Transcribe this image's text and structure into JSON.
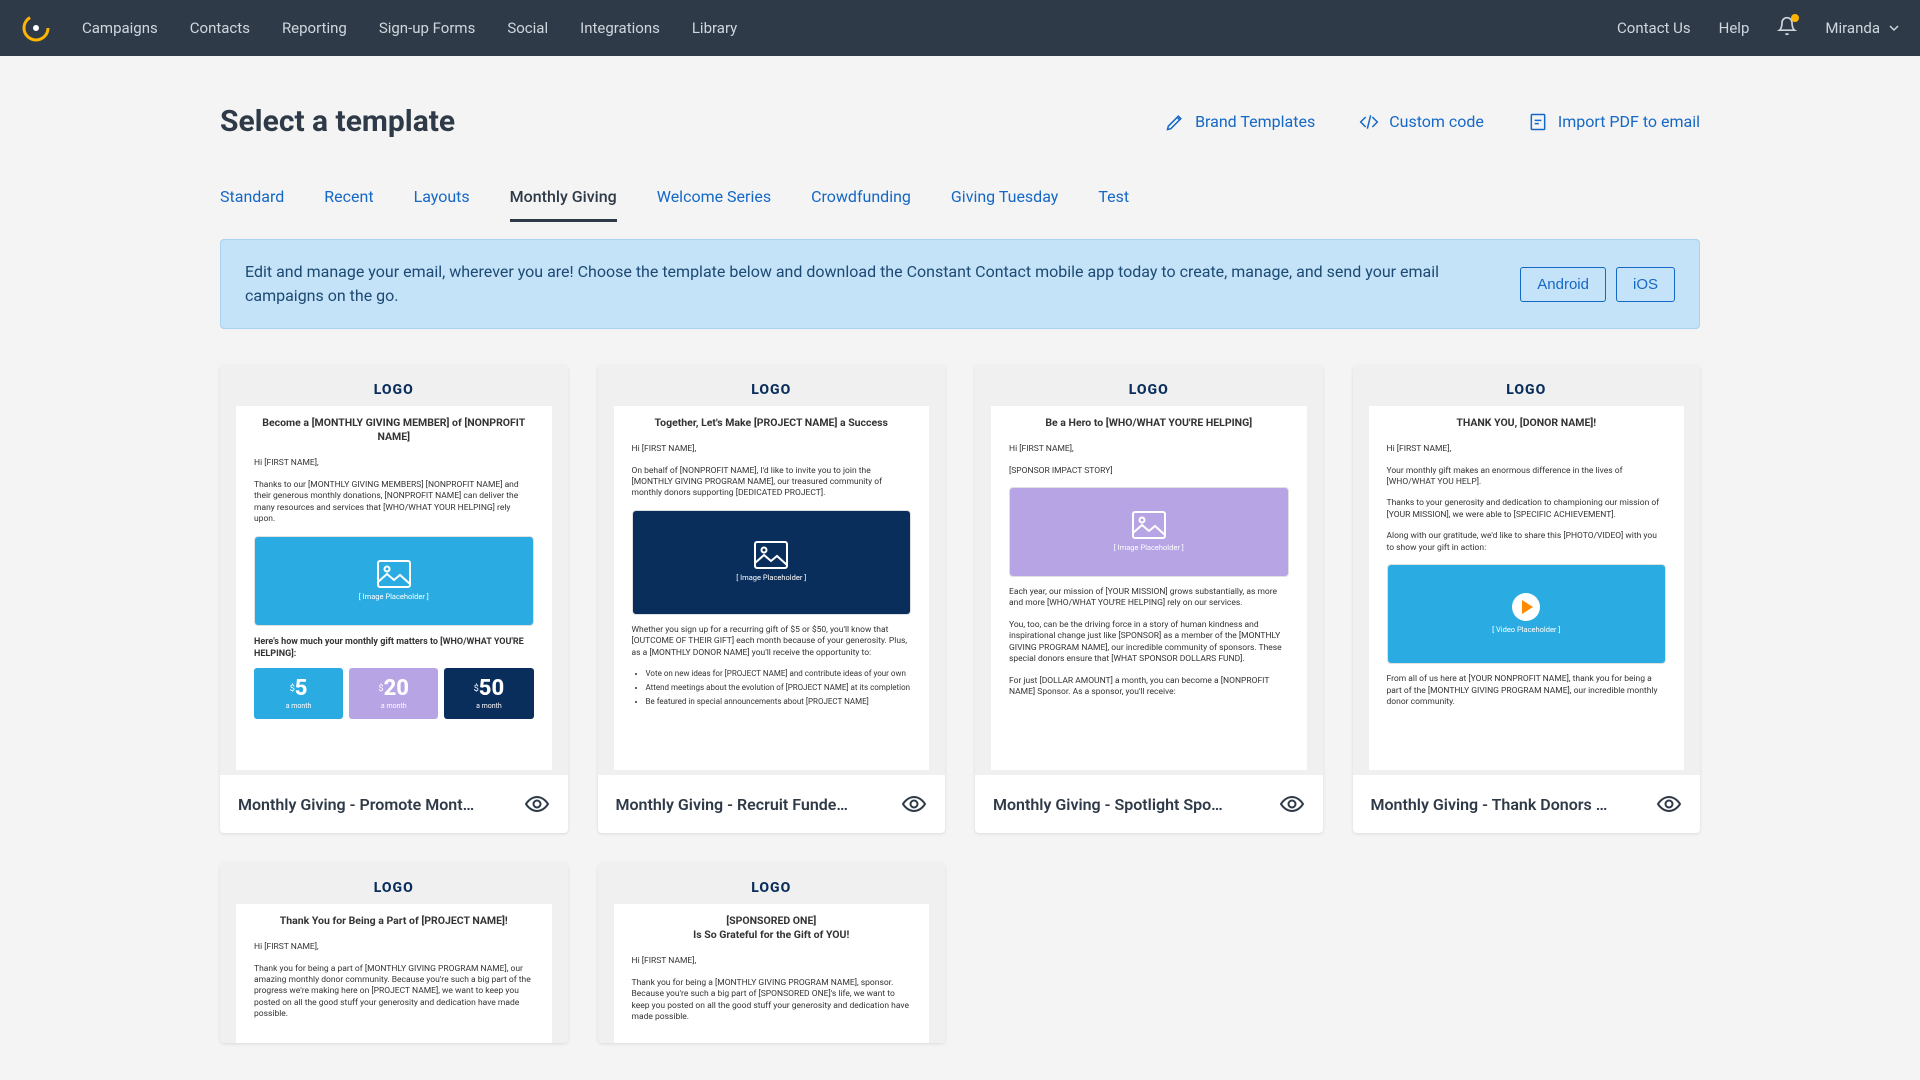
{
  "header": {
    "nav": [
      "Campaigns",
      "Contacts",
      "Reporting",
      "Sign-up Forms",
      "Social",
      "Integrations",
      "Library"
    ],
    "contact": "Contact Us",
    "help": "Help",
    "user": "Miranda"
  },
  "page": {
    "title": "Select a template",
    "actions": {
      "brand": "Brand Templates",
      "custom": "Custom code",
      "import": "Import PDF to email"
    }
  },
  "tabs": [
    "Standard",
    "Recent",
    "Layouts",
    "Monthly Giving",
    "Welcome Series",
    "Crowdfunding",
    "Giving Tuesday",
    "Test"
  ],
  "active_tab": 3,
  "banner": {
    "text": "Edit and manage your email, wherever you are! Choose the template below and download the Constant Contact mobile app today to create, manage, and send your email campaigns on the go.",
    "android": "Android",
    "ios": "iOS"
  },
  "templates": [
    {
      "title": "Monthly Giving - Promote Mont…"
    },
    {
      "title": "Monthly Giving - Recruit Funde…"
    },
    {
      "title": "Monthly Giving - Spotlight Spo…"
    },
    {
      "title": "Monthly Giving - Thank Donors …"
    }
  ],
  "previews": {
    "logo": "LOGO",
    "hi": "Hi [FIRST NAME],",
    "img_ph": "[ Image Placeholder ]",
    "vid_ph": "[ Video Placeholder ]",
    "0": {
      "head": "Become a [MONTHLY GIVING MEMBER] of [NONPROFIT NAME]",
      "body": "Thanks to our [MONTHLY GIVING MEMBERS] [NONPROFIT NAME] and their generous monthly donations, [NONPROFIT NAME] can deliver the many resources and services that [WHO/WHAT YOUR HELPING] rely upon.",
      "sub": "Here's how much your monthly gift matters to [WHO/WHAT YOU'RE HELPING]:",
      "month": "a month"
    },
    "1": {
      "head": "Together, Let's Make [PROJECT NAME] a Success",
      "body": "On behalf of [NONPROFIT NAME], I'd like to invite you to join the [MONTHLY GIVING PROGRAM NAME], our treasured community of monthly donors supporting [DEDICATED PROJECT].",
      "body2": "Whether you sign up for a recurring gift of $5 or $50, you'll know that [OUTCOME OF THEIR GIFT] each month because of your generosity. Plus, as a [MONTHLY DONOR NAME] you'll receive the opportunity to:",
      "bullets": [
        "Vote on new ideas for [PROJECT NAME] and contribute ideas of your own",
        "Attend meetings about the evolution of [PROJECT NAME] at its completion",
        "Be featured in special announcements about [PROJECT NAME]"
      ]
    },
    "2": {
      "head": "Be a Hero to [WHO/WHAT YOU'RE HELPING]",
      "sis": "[SPONSOR IMPACT STORY]",
      "body": "Each year, our mission of [YOUR MISSION] grows substantially, as more and more [WHO/WHAT YOU'RE HELPING] rely on our services.",
      "body2": "You, too, can be the driving force in a story of human kindness and inspirational change just like [SPONSOR] as a member of the [MONTHLY GIVING PROGRAM NAME], our incredible community of sponsors. These special donors ensure that [WHAT SPONSOR DOLLARS FUND].",
      "body3": "For just [DOLLAR AMOUNT] a month, you can become a [NONPROFIT NAME] Sponsor. As a sponsor, you'll receive:"
    },
    "3": {
      "head": "THANK YOU, [DONOR NAME]!",
      "body": "Your monthly gift makes an enormous difference in the lives of [WHO/WHAT YOU HELP].",
      "body2": "Thanks to your generosity and dedication to championing our mission of [YOUR MISSION], we were able to [SPECIFIC ACHIEVEMENT].",
      "body3": "Along with our gratitude, we'd like to share this [PHOTO/VIDEO] with you to show your gift in action:",
      "body4": "From all of us here at [YOUR NONPROFIT NAME], thank you for being a part of the [MONTHLY GIVING PROGRAM NAME], our incredible monthly donor community."
    },
    "4": {
      "head": "Thank You for Being a Part of [PROJECT NAME]!",
      "body": "Thank you for being a part of [MONTHLY GIVING PROGRAM NAME], our amazing monthly donor community. Because you're such a big part of the progress we're making here on [PROJECT NAME], we want to keep you posted on all the good stuff your generosity and dedication have made possible."
    },
    "5": {
      "head1": "[SPONSORED ONE]",
      "head2": "Is So Grateful for the Gift of YOU!",
      "body": "Thank you for being a [MONTHLY GIVING PROGRAM NAME], sponsor. Because you're such a big part of [SPONSORED ONE]'s life, we want to keep you posted on all the good stuff your generosity and dedication have made possible."
    }
  }
}
